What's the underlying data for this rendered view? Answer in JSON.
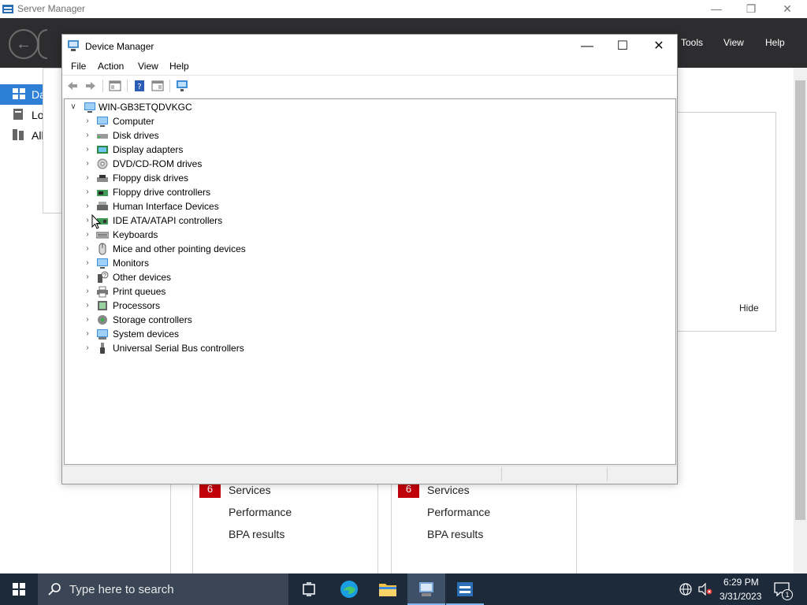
{
  "server_manager": {
    "title": "Server Manager",
    "menu": [
      "Tools",
      "View",
      "Help"
    ],
    "left_items": [
      "Da",
      "Lo",
      "All"
    ],
    "hide_label": "Hide",
    "tiles": [
      {
        "badge": "6",
        "services": "Services",
        "performance": "Performance",
        "bpa": "BPA results"
      },
      {
        "badge": "6",
        "services": "Services",
        "performance": "Performance",
        "bpa": "BPA results"
      }
    ]
  },
  "device_manager": {
    "title": "Device Manager",
    "menu": [
      "File",
      "Action",
      "View",
      "Help"
    ],
    "root": "WIN-GB3ETQDVKGC",
    "categories": [
      {
        "label": "Computer",
        "icon": "computer-icon"
      },
      {
        "label": "Disk drives",
        "icon": "disk-drive-icon"
      },
      {
        "label": "Display adapters",
        "icon": "display-adapter-icon"
      },
      {
        "label": "DVD/CD-ROM drives",
        "icon": "dvd-icon"
      },
      {
        "label": "Floppy disk drives",
        "icon": "floppy-drive-icon"
      },
      {
        "label": "Floppy drive controllers",
        "icon": "floppy-controller-icon"
      },
      {
        "label": "Human Interface Devices",
        "icon": "hid-icon"
      },
      {
        "label": "IDE ATA/ATAPI controllers",
        "icon": "ide-controller-icon"
      },
      {
        "label": "Keyboards",
        "icon": "keyboard-icon"
      },
      {
        "label": "Mice and other pointing devices",
        "icon": "mouse-icon"
      },
      {
        "label": "Monitors",
        "icon": "monitor-icon"
      },
      {
        "label": "Other devices",
        "icon": "unknown-device-icon"
      },
      {
        "label": "Print queues",
        "icon": "printer-icon"
      },
      {
        "label": "Processors",
        "icon": "processor-icon"
      },
      {
        "label": "Storage controllers",
        "icon": "storage-controller-icon"
      },
      {
        "label": "System devices",
        "icon": "system-devices-icon"
      },
      {
        "label": "Universal Serial Bus controllers",
        "icon": "usb-icon"
      }
    ]
  },
  "taskbar": {
    "search_placeholder": "Type here to search",
    "time": "6:29 PM",
    "date": "3/31/2023",
    "notification_count": "1"
  },
  "colors": {
    "sm_header": "#2d2d30",
    "selection": "#2e7fd6",
    "badge_red": "#c1000b",
    "taskbar": "#1c2a3a"
  }
}
